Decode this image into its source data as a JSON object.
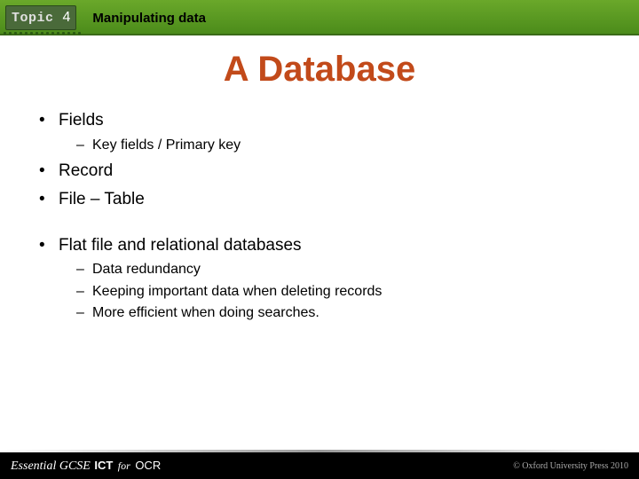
{
  "header": {
    "topic_label": "Topic",
    "topic_number": "4",
    "section_title": "Manipulating data"
  },
  "slide": {
    "title": "A Database",
    "bullets": [
      {
        "text": "Fields",
        "children": [
          "Key fields / Primary key"
        ]
      },
      {
        "text": "Record"
      },
      {
        "text": "File – Table"
      },
      {
        "spacer": true
      },
      {
        "text": "Flat file and relational databases",
        "children": [
          "Data redundancy",
          "Keeping important data when deleting records",
          "More efficient when doing searches."
        ]
      }
    ]
  },
  "footer": {
    "brand_essential": "Essential",
    "brand_gcse": "GCSE",
    "brand_ict": "ICT",
    "brand_for": "for",
    "brand_ocr": "OCR",
    "copyright": "© Oxford University Press 2010"
  }
}
